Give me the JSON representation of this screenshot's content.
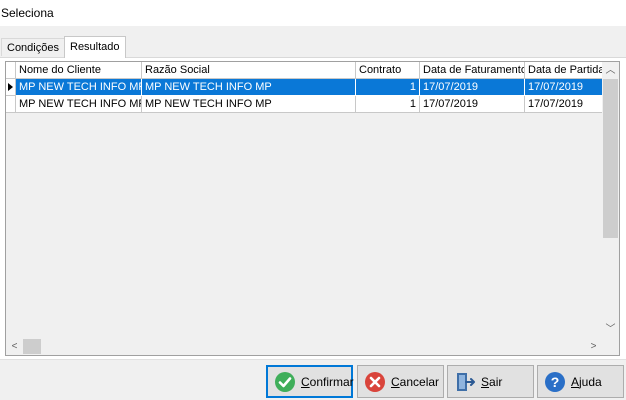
{
  "window": {
    "title": "Seleciona"
  },
  "tabs": [
    {
      "label": "Condições",
      "active": false
    },
    {
      "label": "Resultado",
      "active": true
    }
  ],
  "grid": {
    "columns": [
      "Nome do Cliente",
      "Razão Social",
      "Contrato",
      "Data de Faturamento",
      "Data de Partida"
    ],
    "rows": [
      {
        "cells": [
          "MP NEW TECH INFO MP",
          "MP NEW TECH INFO MP",
          "1",
          "17/07/2019",
          "17/07/2019"
        ],
        "selected": true
      },
      {
        "cells": [
          "MP NEW TECH INFO MP",
          "MP NEW TECH INFO MP",
          "1",
          "17/07/2019",
          "17/07/2019"
        ],
        "selected": false
      }
    ]
  },
  "buttons": {
    "confirmar": {
      "first": "C",
      "rest": "onfirmar"
    },
    "cancelar": {
      "first": "C",
      "rest": "ancelar"
    },
    "sair": {
      "first": "S",
      "rest": "air"
    },
    "ajuda": {
      "first": "A",
      "rest": "juda"
    }
  },
  "icons": {
    "confirm": "check-circle-icon",
    "cancel": "x-circle-icon",
    "exit": "door-exit-icon",
    "help": "question-circle-icon"
  },
  "colors": {
    "selection": "#0a78d7",
    "focus_border": "#0078d7"
  }
}
